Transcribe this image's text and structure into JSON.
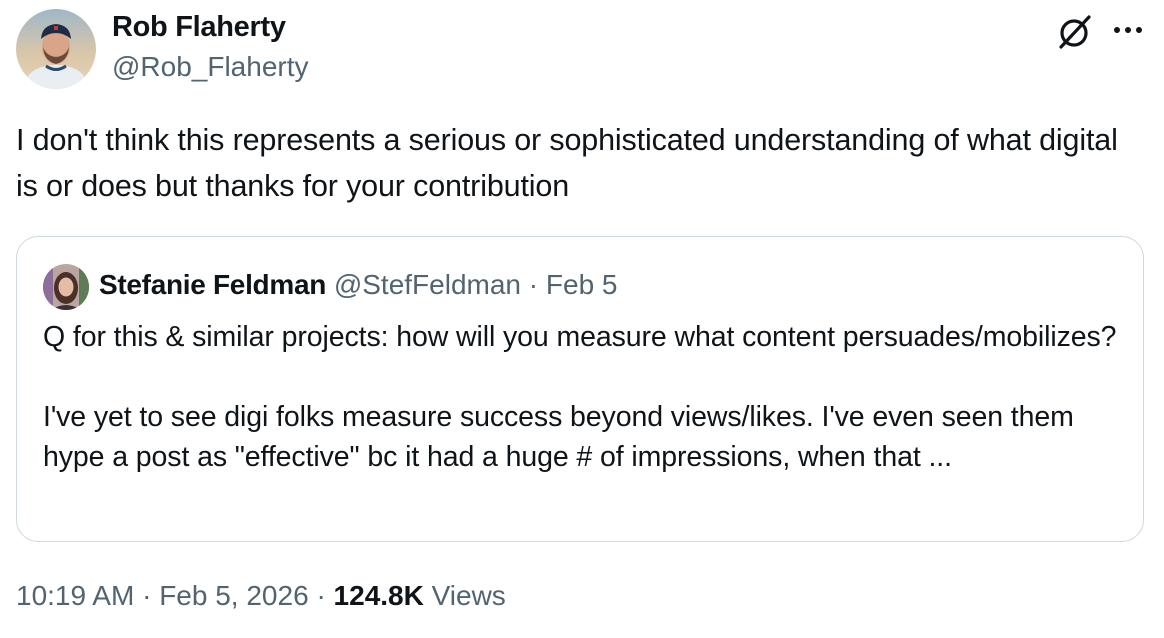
{
  "tweet": {
    "author": {
      "name": "Rob Flaherty",
      "handle": "@Rob_Flaherty"
    },
    "text": "I don't think this represents a serious or sophisticated understanding of what digital is or does but thanks for your contribution",
    "icons": {
      "grok": "grok-icon",
      "more": "more-icon"
    },
    "quote": {
      "author_name": "Stefanie Feldman",
      "author_handle": "@StefFeldman",
      "separator": "·",
      "date": "Feb 5",
      "paragraphs": [
        "Q for this & similar projects: how will you measure what content persuades/mobilizes?",
        "I've yet to see digi folks measure success beyond views/likes. I've even seen them hype a post as \"effective\" bc it had a huge # of impressions, when that ..."
      ]
    },
    "footer": {
      "time": "10:19 AM",
      "separator": "·",
      "date": "Feb 5, 2026",
      "separator2": "·",
      "views_count": "124.8K",
      "views_label": "Views"
    }
  },
  "colors": {
    "text_primary": "#0f1419",
    "text_secondary": "#536471",
    "border": "#cfd9de"
  }
}
